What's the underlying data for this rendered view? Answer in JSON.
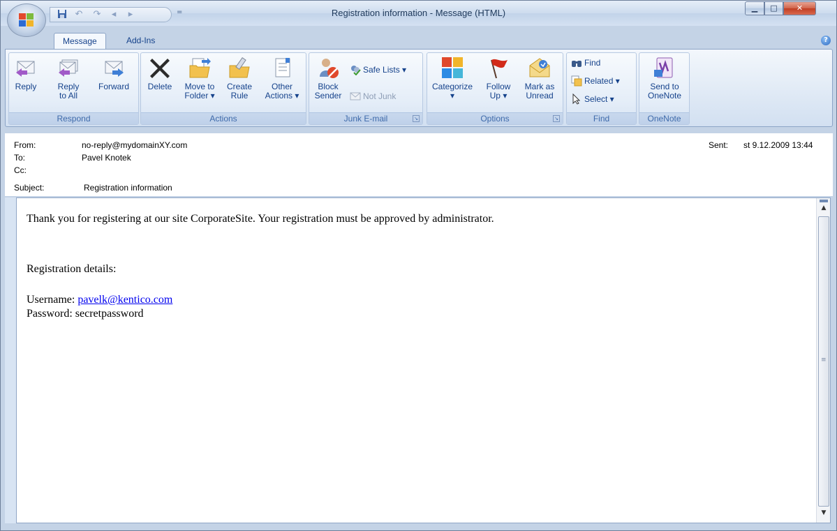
{
  "window": {
    "title": "Registration information - Message (HTML)",
    "accent": "#15428b",
    "min_glyph": "▁",
    "max_glyph": "□",
    "close_glyph": "✕"
  },
  "qat": {
    "icons": [
      "save-icon",
      "undo-icon",
      "redo-icon",
      "previous-item-icon",
      "next-item-icon",
      "customize-qat-icon"
    ],
    "dropdown_glyph": "="
  },
  "tabs": [
    {
      "label": "Message",
      "active": true
    },
    {
      "label": "Add-Ins",
      "active": false
    }
  ],
  "help_glyph": "?",
  "ribbon": {
    "respond": {
      "label": "Respond",
      "buttons": [
        {
          "label": "Reply",
          "icon": "reply-icon"
        },
        {
          "label": "Reply\nto All",
          "icon": "reply-all-icon"
        },
        {
          "label": "Forward",
          "icon": "forward-icon"
        }
      ]
    },
    "actions": {
      "label": "Actions",
      "buttons": [
        {
          "label": "Delete",
          "icon": "delete-icon"
        },
        {
          "label": "Move to\nFolder ▾",
          "icon": "move-to-folder-icon"
        },
        {
          "label": "Create\nRule",
          "icon": "create-rule-icon"
        },
        {
          "label": "Other\nActions ▾",
          "icon": "other-actions-icon"
        }
      ]
    },
    "junk": {
      "label": "Junk E-mail",
      "block_sender": "Block\nSender",
      "safe_lists": "Safe Lists ▾",
      "not_junk": "Not Junk"
    },
    "options": {
      "label": "Options",
      "buttons": [
        {
          "label": "Categorize\n▾",
          "icon": "categorize-icon"
        },
        {
          "label": "Follow\nUp ▾",
          "icon": "follow-up-flag-icon"
        },
        {
          "label": "Mark as\nUnread",
          "icon": "mark-unread-icon"
        }
      ]
    },
    "find": {
      "label": "Find",
      "find": "Find",
      "related": "Related ▾",
      "select": "Select ▾"
    },
    "onenote": {
      "label": "OneNote",
      "send": "Send to\nOneNote"
    }
  },
  "headers": {
    "from_label": "From:",
    "from_value": "no-reply@mydomainXY.com",
    "to_label": "To:",
    "to_value": "Pavel Knotek",
    "cc_label": "Cc:",
    "cc_value": "",
    "subject_label": "Subject:",
    "subject_value": "Registration information",
    "sent_label": "Sent:",
    "sent_value": "st 9.12.2009 13:44"
  },
  "message": {
    "line1": "Thank you for registering at our site CorporateSite. Your registration must be approved by administrator.",
    "details_heading": "Registration details:",
    "username_label": "Username: ",
    "username_value": "pavelk@kentico.com",
    "password_label": "Password: ",
    "password_value": "secretpassword"
  },
  "scrollbar": {
    "up_glyph": "▲",
    "down_glyph": "▼",
    "grip_glyph": "≡"
  }
}
